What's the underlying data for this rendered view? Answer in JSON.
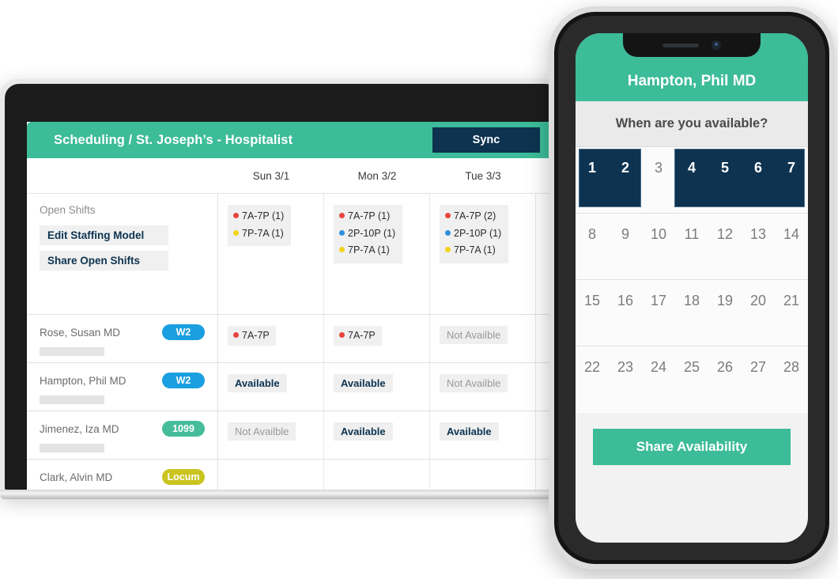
{
  "desktop": {
    "header": {
      "title": "Scheduling / St. Joseph’s - Hospitalist",
      "sync_label": "Sync"
    },
    "columns": [
      "Sun 3/1",
      "Mon 3/2",
      "Tue 3/3"
    ],
    "open_shifts": {
      "label": "Open Shifts",
      "edit_staffing_model_label": "Edit Staffing Model",
      "share_open_shifts_label": "Share Open Shifts",
      "cells": [
        {
          "shifts": [
            {
              "color": "#e8453c",
              "text": "7A-7P (1)"
            },
            {
              "color": "#f2d21a",
              "text": "7P-7A (1)"
            }
          ]
        },
        {
          "shifts": [
            {
              "color": "#e8453c",
              "text": "7A-7P (1)"
            },
            {
              "color": "#2f8fdd",
              "text": "2P-10P (1)"
            },
            {
              "color": "#f2d21a",
              "text": "7P-7A (1)"
            }
          ]
        },
        {
          "shifts": [
            {
              "color": "#e8453c",
              "text": "7A-7P (2)"
            },
            {
              "color": "#2f8fdd",
              "text": "2P-10P (1)"
            },
            {
              "color": "#f2d21a",
              "text": "7P-7A (1)"
            }
          ]
        }
      ]
    },
    "providers": [
      {
        "name": "Rose, Susan MD",
        "badge": "W2",
        "badge_color": "#1a9fe0",
        "cells": [
          {
            "type": "shift",
            "color": "#e8453c",
            "text": "7A-7P"
          },
          {
            "type": "shift",
            "color": "#e8453c",
            "text": "7A-7P"
          },
          {
            "type": "unavailable",
            "text": "Not Availble"
          }
        ]
      },
      {
        "name": "Hampton, Phil MD",
        "badge": "W2",
        "badge_color": "#1a9fe0",
        "cells": [
          {
            "type": "available",
            "text": "Available"
          },
          {
            "type": "available",
            "text": "Available"
          },
          {
            "type": "unavailable",
            "text": "Not Availble"
          }
        ]
      },
      {
        "name": "Jimenez, Iza MD",
        "badge": "1099",
        "badge_color": "#45bd9a",
        "cells": [
          {
            "type": "unavailable",
            "text": "Not Availble"
          },
          {
            "type": "available",
            "text": "Available"
          },
          {
            "type": "available",
            "text": "Available"
          }
        ]
      },
      {
        "name": "Clark, Alvin MD",
        "badge": "Locum",
        "badge_color": "#c9c41f",
        "cells": [
          {
            "type": "empty",
            "text": ""
          },
          {
            "type": "empty",
            "text": ""
          },
          {
            "type": "empty",
            "text": ""
          }
        ]
      }
    ]
  },
  "phone": {
    "header_title": "Hampton, Phil MD",
    "prompt": "When are you available?",
    "share_button_label": "Share Availability",
    "calendar": {
      "rows": [
        {
          "days": [
            "1",
            "2",
            "3",
            "4",
            "5",
            "6",
            "7"
          ],
          "selected": [
            true,
            true,
            false,
            true,
            true,
            true,
            true
          ]
        },
        {
          "days": [
            "8",
            "9",
            "10",
            "11",
            "12",
            "13",
            "14"
          ],
          "selected": [
            false,
            false,
            false,
            false,
            false,
            false,
            false
          ]
        },
        {
          "days": [
            "15",
            "16",
            "17",
            "18",
            "19",
            "20",
            "21"
          ],
          "selected": [
            false,
            false,
            false,
            false,
            false,
            false,
            false
          ]
        },
        {
          "days": [
            "22",
            "23",
            "24",
            "25",
            "26",
            "27",
            "28"
          ],
          "selected": [
            false,
            false,
            false,
            false,
            false,
            false,
            false
          ]
        }
      ]
    }
  },
  "colors": {
    "brand_teal": "#3cbc98",
    "navy": "#0d3350",
    "red_shift": "#e8453c",
    "blue_shift": "#2f8fdd",
    "yellow_shift": "#f2d21a"
  }
}
